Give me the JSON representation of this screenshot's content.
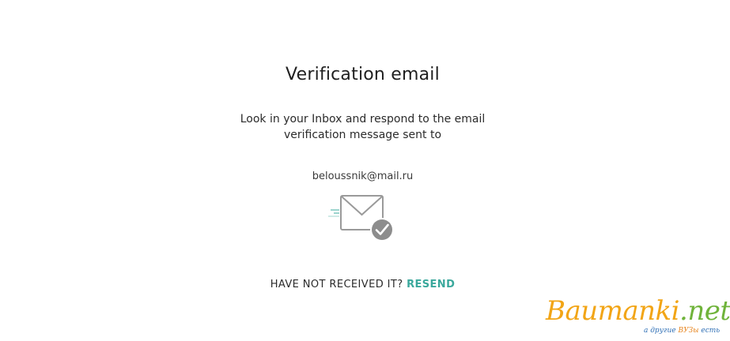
{
  "verification": {
    "title": "Verification email",
    "message_line1": "Look in your Inbox and respond to the email",
    "message_line2": "verification message sent to",
    "email": "beloussnik@mail.ru",
    "envelope_icon": "envelope-check-icon",
    "not_received_label": "HAVE NOT RECEIVED IT?",
    "resend_label": "RESEND"
  },
  "watermark": {
    "brand": "Baumanki",
    "domain": ".net",
    "tagline_prefix": "а другие ",
    "tagline_highlight": "ВУЗы",
    "tagline_suffix": " есть"
  },
  "colors": {
    "accent": "#3aa89c",
    "icon_gray": "#9a9a9a",
    "check_badge": "#8d8d8d",
    "watermark_orange": "#f2a516",
    "watermark_green": "#6fb33a"
  }
}
